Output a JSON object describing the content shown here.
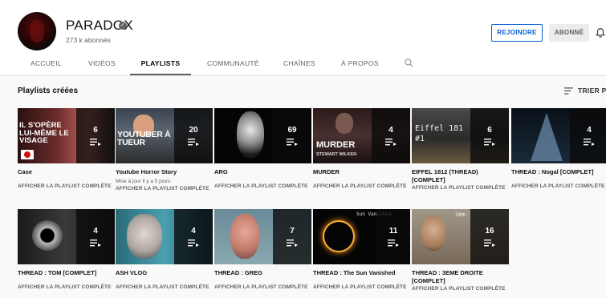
{
  "channel": {
    "name": "PARADOX",
    "subscribers": "273 k abonnés",
    "join_label": "REJOINDRE",
    "subscribed_label": "ABONNÉ"
  },
  "tabs": [
    {
      "label": "ACCUEIL"
    },
    {
      "label": "VIDÉOS"
    },
    {
      "label": "PLAYLISTS"
    },
    {
      "label": "COMMUNAUTÉ"
    },
    {
      "label": "CHAÎNES"
    },
    {
      "label": "À PROPOS"
    }
  ],
  "section": {
    "title": "Playlists créées",
    "sort_label": "TRIER PA"
  },
  "view_full_label": "AFFICHER LA PLAYLIST COMPLÈTE",
  "playlists": [
    {
      "title": "Case",
      "count": "6",
      "thumb_text": "IL S'OPÈRE LUI-MÊME LE VISAGE"
    },
    {
      "title": "Youtube Horror Story",
      "count": "20",
      "meta": "Mise à jour il y a 5 jours",
      "thumb_text": "YOUTUBER À TUEUR"
    },
    {
      "title": "ARG",
      "count": "69"
    },
    {
      "title": "MURDER",
      "count": "4",
      "thumb_text": "MURDER",
      "thumb_sub": "STEWART WILKEN"
    },
    {
      "title": "EIFFEL 1812 (THREAD) [COMPLET]",
      "count": "6",
      "thumb_text": "Eiffel 181",
      "thumb_sub": "#1"
    },
    {
      "title": "THREAD : Nogal [COMPLET]",
      "count": "4"
    },
    {
      "title": "THREAD : TOM [COMPLET]",
      "count": "4"
    },
    {
      "title": "ASH VLOG",
      "count": "4"
    },
    {
      "title": "THREAD : GREG",
      "count": "7"
    },
    {
      "title": "THREAD : The Sun Vanished",
      "count": "11",
      "thumb_text": "Sun Vanished"
    },
    {
      "title": "THREAD : 3EME DROITE [COMPLET]",
      "count": "16",
      "thumb_text": "3èm"
    }
  ]
}
